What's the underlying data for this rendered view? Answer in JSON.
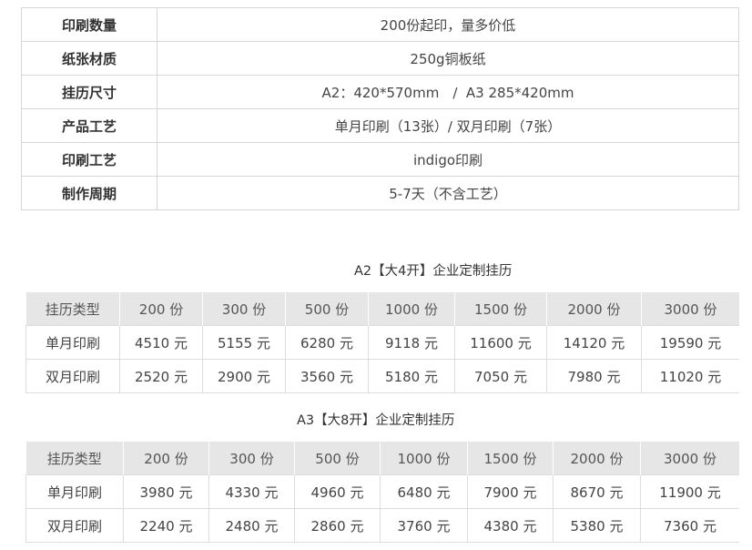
{
  "spec": [
    {
      "key": "印刷数量",
      "value": "200份起印，量多价低"
    },
    {
      "key": "纸张材质",
      "value": "250g铜板纸"
    },
    {
      "key": "挂历尺寸",
      "value": "A2：420*570mm　/  A3 285*420mm"
    },
    {
      "key": "产品工艺",
      "value": "单月印刷（13张）/ 双月印刷（7张）"
    },
    {
      "key": "印刷工艺",
      "value": "indigo印刷"
    },
    {
      "key": "制作周期",
      "value": "5-7天（不含工艺）"
    }
  ],
  "a2": {
    "title": "A2【大4开】企业定制挂历",
    "headers": [
      "挂历类型",
      "200 份",
      "300 份",
      "500 份",
      "1000 份",
      "1500 份",
      "2000 份",
      "3000 份"
    ],
    "rows": [
      [
        "单月印刷",
        "4510 元",
        "5155 元",
        "6280 元",
        "9118 元",
        "11600 元",
        "14120 元",
        "19590 元"
      ],
      [
        "双月印刷",
        "2520 元",
        "2900 元",
        "3560 元",
        "5180 元",
        "7050 元",
        "7980 元",
        "11020 元"
      ]
    ]
  },
  "a3": {
    "title": "A3【大8开】企业定制挂历",
    "headers": [
      "挂历类型",
      "200 份",
      "300 份",
      "500 份",
      "1000 份",
      "1500 份",
      "2000 份",
      "3000 份"
    ],
    "rows": [
      [
        "单月印刷",
        "3980 元",
        "4330 元",
        "4960 元",
        "6480 元",
        "7900 元",
        "8670 元",
        "11900 元"
      ],
      [
        "双月印刷",
        "2240 元",
        "2480 元",
        "2860 元",
        "3760 元",
        "4380 元",
        "5380 元",
        "7360 元"
      ]
    ]
  }
}
